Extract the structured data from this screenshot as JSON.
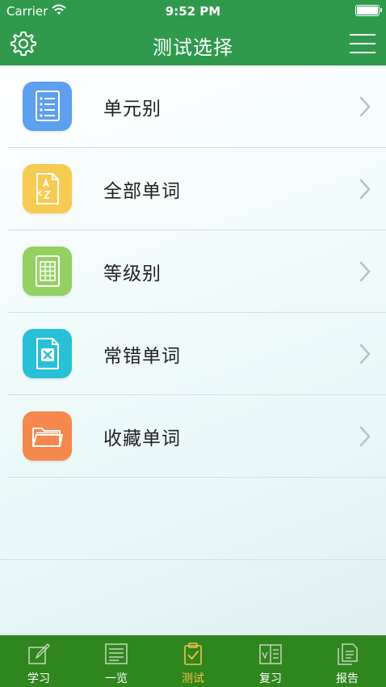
{
  "status_bar": {
    "carrier": "Carrier",
    "time": "9:52 PM"
  },
  "nav": {
    "title": "测试选择"
  },
  "colors": {
    "header_green": "#2f9a4b",
    "tabbar_green": "#2f861c",
    "active_tab": "#f5c04a",
    "tile_blue": "#5d9ff0",
    "tile_yellow": "#f7cb50",
    "tile_green": "#93d162",
    "tile_cyan": "#27c0d8",
    "tile_orange": "#f5884c"
  },
  "list": {
    "items": [
      {
        "label": "单元别",
        "icon": "list-document-icon"
      },
      {
        "label": "全部单词",
        "icon": "az-document-icon"
      },
      {
        "label": "等级别",
        "icon": "spreadsheet-document-icon"
      },
      {
        "label": "常错单词",
        "icon": "x-document-icon"
      },
      {
        "label": "收藏单词",
        "icon": "folder-icon"
      }
    ]
  },
  "tabs": [
    {
      "label": "学习",
      "icon": "pencil-note-icon",
      "active": false
    },
    {
      "label": "一览",
      "icon": "list-board-icon",
      "active": false
    },
    {
      "label": "测试",
      "icon": "clipboard-check-icon",
      "active": true
    },
    {
      "label": "复习",
      "icon": "book-icon",
      "active": false
    },
    {
      "label": "报告",
      "icon": "report-document-icon",
      "active": false
    }
  ]
}
